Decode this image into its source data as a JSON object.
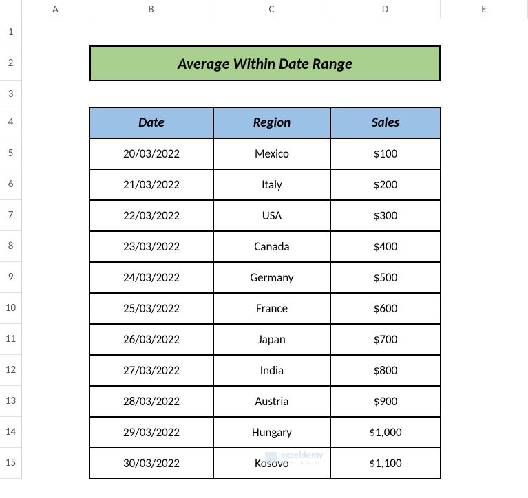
{
  "columns": [
    "",
    "A",
    "B",
    "C",
    "D",
    "E"
  ],
  "rows": [
    "1",
    "2",
    "3",
    "4",
    "5",
    "6",
    "7",
    "8",
    "9",
    "10",
    "11",
    "12",
    "13",
    "14",
    "15"
  ],
  "title": "Average Within Date Range",
  "headers": {
    "date": "Date",
    "region": "Region",
    "sales": "Sales"
  },
  "data": [
    {
      "date": "20/03/2022",
      "region": "Mexico",
      "sales": "$100"
    },
    {
      "date": "21/03/2022",
      "region": "Italy",
      "sales": "$200"
    },
    {
      "date": "22/03/2022",
      "region": "USA",
      "sales": "$300"
    },
    {
      "date": "23/03/2022",
      "region": "Canada",
      "sales": "$400"
    },
    {
      "date": "24/03/2022",
      "region": "Germany",
      "sales": "$500"
    },
    {
      "date": "25/03/2022",
      "region": "France",
      "sales": "$600"
    },
    {
      "date": "26/03/2022",
      "region": "Japan",
      "sales": "$700"
    },
    {
      "date": "27/03/2022",
      "region": "India",
      "sales": "$800"
    },
    {
      "date": "28/03/2022",
      "region": "Austria",
      "sales": "$900"
    },
    {
      "date": "29/03/2022",
      "region": "Hungary",
      "sales": "$1,000"
    },
    {
      "date": "30/03/2022",
      "region": "Kosovo",
      "sales": "$1,100"
    }
  ],
  "watermark": {
    "main": "exceldemy",
    "sub": "EXCEL · DATA · BI"
  }
}
